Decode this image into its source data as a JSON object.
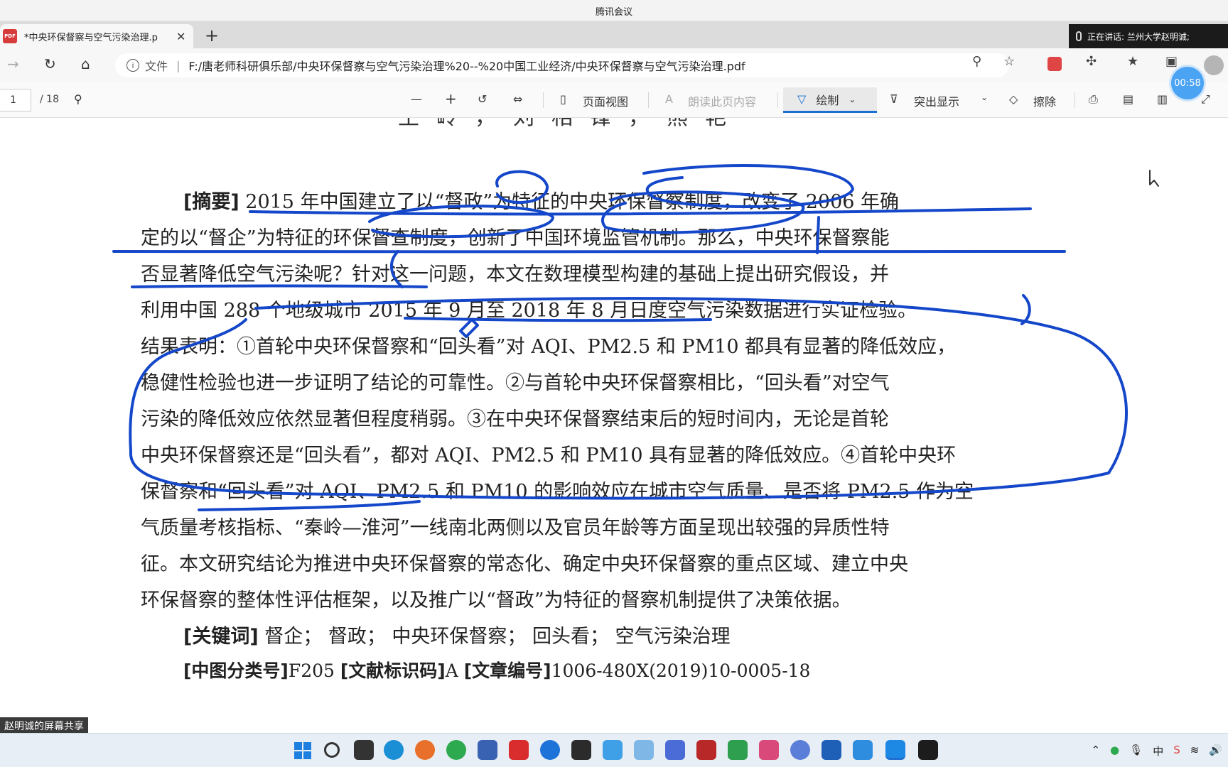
{
  "meeting": {
    "title": "腾讯会议",
    "speaking": "正在讲话: 兰州大学赵明诚;",
    "timer": "00:58",
    "share_label": "赵明诚的屏幕共享"
  },
  "browser": {
    "tab_title": "*中央环保督察与空气污染治理.p",
    "pdf_icon_text": "PDF",
    "file_label": "文件",
    "url": "F:/唐老师科研俱乐部/中央环保督察与空气污染治理%20--%20中国工业经济/中央环保督察与空气污染治理.pdf"
  },
  "toolbar": {
    "page_current": "1",
    "page_total": "/ 18",
    "zoom_out": "—",
    "zoom_in": "+",
    "page_view": "页面视图",
    "read_aloud": "朗读此页内容",
    "draw": "绘制",
    "highlight": "突出显示",
    "erase": "擦除"
  },
  "document": {
    "authors": "王岭，刘相锋，熊艳",
    "lines": [
      {
        "label": "[摘要]",
        "text": "  2015 年中国建立了以“督政”为特征的中央环保督察制度，改变了 2006 年确"
      },
      {
        "text": "定的以“督企”为特征的环保督查制度，创新了中国环境监管机制。那么，中央环保督察能"
      },
      {
        "text": "否显著降低空气污染呢？针对这一问题，本文在数理模型构建的基础上提出研究假设，并"
      },
      {
        "text": "利用中国 288 个地级城市 2015 年 9 月至 2018 年 8 月日度空气污染数据进行实证检验。"
      },
      {
        "text": "结果表明：①首轮中央环保督察和“回头看”对 AQI、PM2.5 和 PM10 都具有显著的降低效应，"
      },
      {
        "text": "稳健性检验也进一步证明了结论的可靠性。②与首轮中央环保督察相比，“回头看”对空气"
      },
      {
        "text": "污染的降低效应依然显著但程度稍弱。③在中央环保督察结束后的短时间内，无论是首轮"
      },
      {
        "text": "中央环保督察还是“回头看”，都对 AQI、PM2.5 和 PM10 具有显著的降低效应。④首轮中央环"
      },
      {
        "text": "保督察和“回头看”对 AQI、PM2.5 和 PM10 的影响效应在城市空气质量、是否将 PM2.5 作为空"
      },
      {
        "text": "气质量考核指标、“秦岭—淮河”一线南北两侧以及官员年龄等方面呈现出较强的异质性特"
      },
      {
        "text": "征。本文研究结论为推进中央环保督察的常态化、确定中央环保督察的重点区域、建立中央"
      },
      {
        "text": "环保督察的整体性评估框架，以及推广以“督政”为特征的督察机制提供了决策依据。"
      },
      {
        "label": "[关键词]",
        "text": "  督企；  督政；  中央环保督察；  回头看；  空气污染治理"
      },
      {
        "label": "[中图分类号]",
        "text": "F205  ",
        "label2": "[文献标识码]",
        "text2": "A  ",
        "label3": "[文章编号]",
        "text3": "1006-480X(2019)10-0005-18"
      }
    ]
  },
  "colors": {
    "annotation_ink": "#1447c9",
    "draw_accent": "#1a6fd1"
  }
}
